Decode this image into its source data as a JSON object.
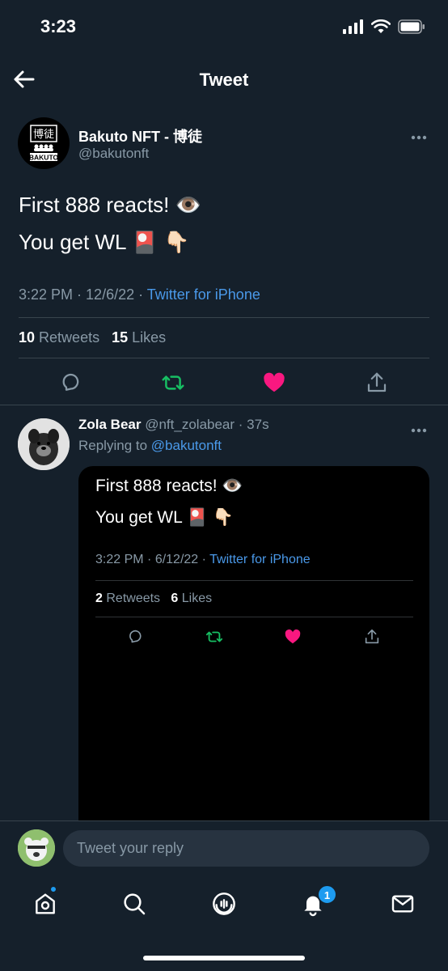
{
  "status_bar": {
    "time": "3:23"
  },
  "header": {
    "title": "Tweet"
  },
  "tweet": {
    "author_name": "Bakuto NFT - 博徒",
    "author_handle": "@bakutonft",
    "avatar_text": "BAKUTO",
    "avatar_kanji": "博徒",
    "text_line_1": "First 888 reacts! 👁️",
    "text_line_2": "You get WL 🎴 👇🏻",
    "time": "3:22 PM",
    "date": "12/6/22",
    "source": "Twitter for iPhone",
    "retweets_count": "10",
    "retweets_label": "Retweets",
    "likes_count": "15",
    "likes_label": "Likes",
    "liked": true,
    "colors": {
      "retweet": "#17bf63",
      "like": "#f91880",
      "link": "#4a99e9"
    }
  },
  "reply": {
    "author_name": "Zola Bear",
    "author_handle": "@nft_zolabear",
    "age": "37s",
    "replying_prefix": "Replying to",
    "replying_handle": "@bakutonft",
    "embed": {
      "text_line_1": "First 888 reacts! 👁️",
      "text_line_2": "You get WL 🎴 👇🏻",
      "time": "3:22 PM",
      "date": "6/12/22",
      "source": "Twitter for iPhone",
      "retweets_count": "2",
      "retweets_label": "Retweets",
      "likes_count": "6",
      "likes_label": "Likes"
    }
  },
  "composer": {
    "placeholder": "Tweet your reply"
  },
  "tab_bar": {
    "items": [
      "home-icon",
      "search-icon",
      "spaces-icon",
      "notifications-icon",
      "messages-icon"
    ],
    "notifications_badge": "1"
  }
}
